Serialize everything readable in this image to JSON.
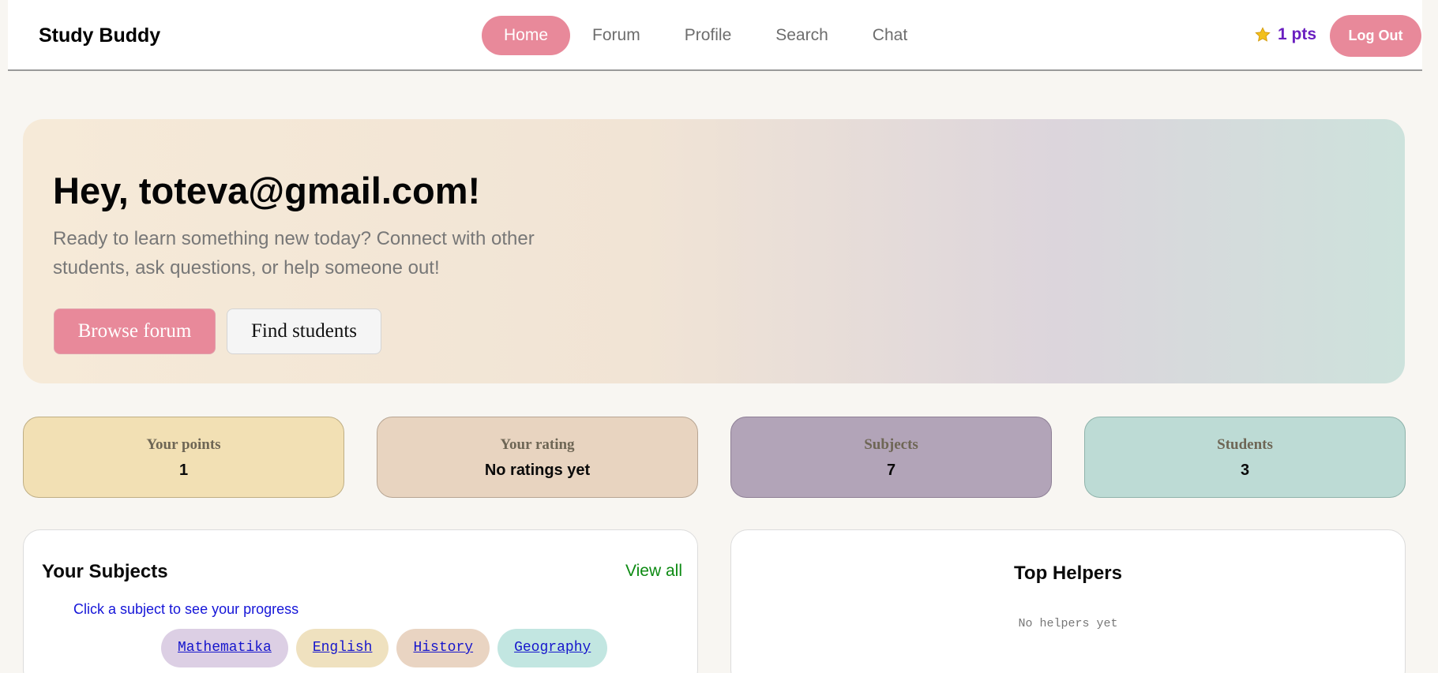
{
  "header": {
    "brand": "Study Buddy",
    "nav": [
      {
        "label": "Home",
        "active": true
      },
      {
        "label": "Forum",
        "active": false
      },
      {
        "label": "Profile",
        "active": false
      },
      {
        "label": "Search",
        "active": false
      },
      {
        "label": "Chat",
        "active": false
      }
    ],
    "points_label": "1 pts",
    "logout_label": "Log Out"
  },
  "hero": {
    "title": "Hey, toteva@gmail.com!",
    "subtitle": "Ready to learn something new today? Connect with other students, ask questions, or help someone out!",
    "primary_button": "Browse forum",
    "secondary_button": "Find students"
  },
  "stats": [
    {
      "label": "Your points",
      "value": "1",
      "bg": "#f2e0b4",
      "border": "#bfae84"
    },
    {
      "label": "Your rating",
      "value": "No ratings yet",
      "bg": "#e8d4c0",
      "border": "#b7a593"
    },
    {
      "label": "Subjects",
      "value": "7",
      "bg": "#b2a4b8",
      "border": "#8e7f96"
    },
    {
      "label": "Students",
      "value": "3",
      "bg": "#bddbd5",
      "border": "#8fb3ab"
    }
  ],
  "subjects_card": {
    "title": "Your Subjects",
    "view_all": "View all",
    "hint": "Click a subject to see your progress",
    "subjects": [
      {
        "label": "Mathematika",
        "color": "#dccfe4"
      },
      {
        "label": "English",
        "color": "#efe1bf"
      },
      {
        "label": "History",
        "color": "#e9d4c2"
      },
      {
        "label": "Geography",
        "color": "#c2e6e1"
      }
    ]
  },
  "helpers_card": {
    "title": "Top Helpers",
    "empty": "No helpers yet"
  },
  "colors": {
    "accent": "#e8899a",
    "points": "#6a1fc0",
    "link_green": "#0c8a12"
  }
}
